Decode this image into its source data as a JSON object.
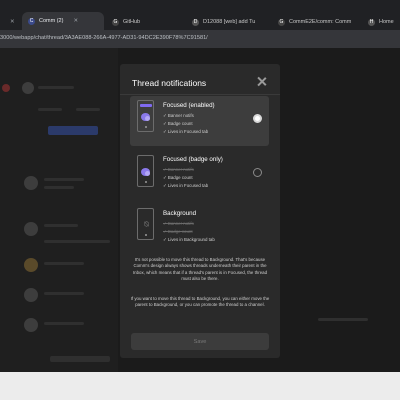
{
  "browser": {
    "tabs": [
      {
        "label": "Comm (2)",
        "favicon": "C"
      },
      {
        "label": "GitHub",
        "favicon": "G"
      },
      {
        "label": "D12088 [web] add Tu",
        "favicon": "D"
      },
      {
        "label": "CommE2E/comm: Comm",
        "favicon": "G"
      },
      {
        "label": "Home",
        "favicon": "H"
      }
    ],
    "url": "3000/webapp/chat/thread/3A3AE088-266A-4977-AD31-94DC2E390F78%7C91581/"
  },
  "modal": {
    "title": "Thread notifications",
    "options": [
      {
        "title": "Focused (enabled)",
        "selected": true,
        "features": [
          {
            "label": "Banner notifs",
            "enabled": true
          },
          {
            "label": "Badge count",
            "enabled": true
          },
          {
            "label": "Lives in Focused tab",
            "enabled": true
          }
        ]
      },
      {
        "title": "Focused (badge only)",
        "selected": false,
        "features": [
          {
            "label": "Banner notifs",
            "enabled": false
          },
          {
            "label": "Badge count",
            "enabled": true
          },
          {
            "label": "Lives in Focused tab",
            "enabled": true
          }
        ]
      },
      {
        "title": "Background",
        "selected": false,
        "features": [
          {
            "label": "Banner notifs",
            "enabled": false
          },
          {
            "label": "Badge count",
            "enabled": false
          },
          {
            "label": "Lives in Background tab",
            "enabled": true
          }
        ]
      }
    ],
    "info_paragraph_1": "It's not possible to move this thread to Background. That's because Comm's design always shows threads underneath their parent in the Inbox, which means that if a thread's parent is in Focused, the thread must also be there.",
    "info_paragraph_2": "If you want to move this thread to Background, you can either move the parent to Background, or you can promote the thread to a channel.",
    "save_label": "Save"
  },
  "colors": {
    "accent": "#7f6af0",
    "modal_bg": "#2a2a2a",
    "overlay": "#1b1b1b"
  }
}
